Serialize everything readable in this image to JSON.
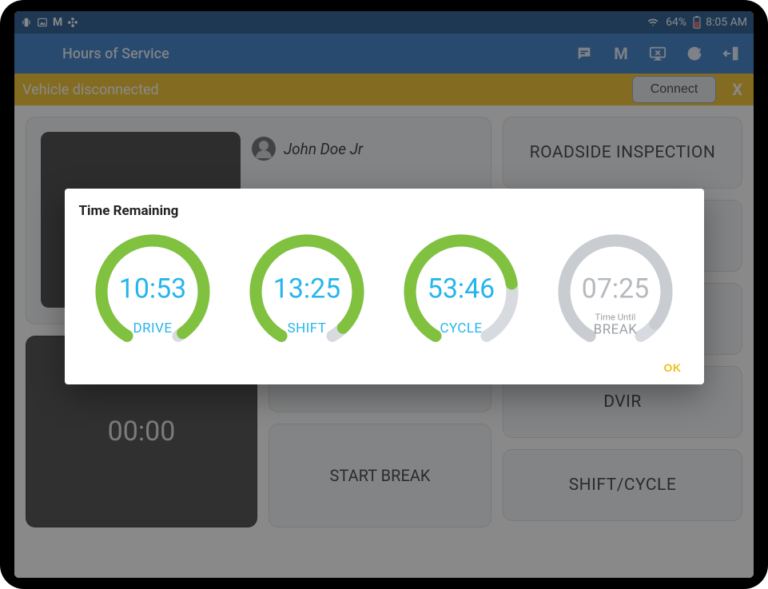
{
  "status": {
    "battery_pct": "64%",
    "time": "8:05 AM",
    "left_m": "M"
  },
  "appbar": {
    "title": "Hours of Service",
    "m_label": "M"
  },
  "banner": {
    "text": "Vehicle disconnected",
    "connect": "Connect",
    "close": "X"
  },
  "main": {
    "username": "John Doe Jr",
    "clock_time": "00:00",
    "start_break": "START BREAK",
    "side": {
      "roadside": "ROADSIDE INSPECTION",
      "dvir": "DVIR",
      "shift_cycle": "SHIFT/CYCLE"
    }
  },
  "modal": {
    "title": "Time Remaining",
    "ok": "OK",
    "gauges": [
      {
        "value": "10:53",
        "label": "DRIVE",
        "fill": 0.98,
        "color": "green"
      },
      {
        "value": "13:25",
        "label": "SHIFT",
        "fill": 0.95,
        "color": "green"
      },
      {
        "value": "53:46",
        "label": "CYCLE",
        "fill": 0.77,
        "color": "green"
      },
      {
        "value": "07:25",
        "label": "BREAK",
        "sublabel": "Time Until",
        "fill": 0.93,
        "color": "gray"
      }
    ]
  },
  "chart_data": [
    {
      "type": "gauge",
      "label": "DRIVE",
      "value_text": "10:53",
      "fill_fraction": 0.98,
      "arc_deg_total": 300,
      "color": "#80c140"
    },
    {
      "type": "gauge",
      "label": "SHIFT",
      "value_text": "13:25",
      "fill_fraction": 0.95,
      "arc_deg_total": 300,
      "color": "#80c140"
    },
    {
      "type": "gauge",
      "label": "CYCLE",
      "value_text": "53:46",
      "fill_fraction": 0.77,
      "arc_deg_total": 300,
      "color": "#80c140"
    },
    {
      "type": "gauge",
      "label": "BREAK",
      "sublabel": "Time Until",
      "value_text": "07:25",
      "fill_fraction": 0.93,
      "arc_deg_total": 300,
      "color": "#c9ccd1"
    }
  ]
}
